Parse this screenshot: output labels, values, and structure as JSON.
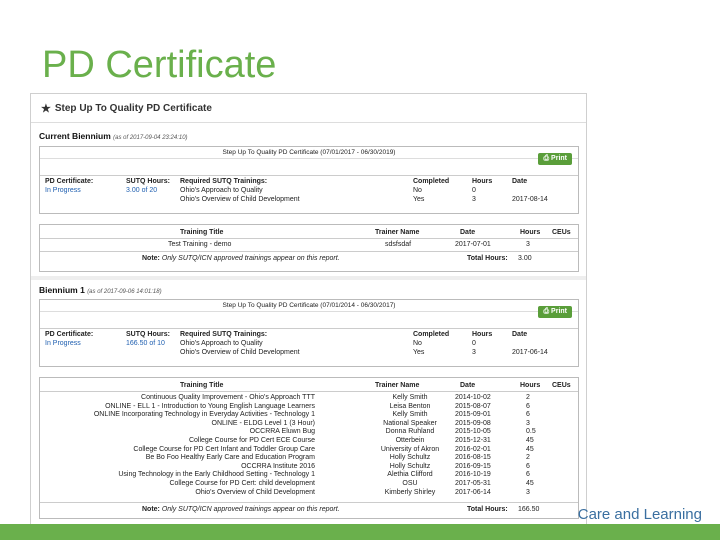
{
  "slide": {
    "title": "PD Certificate",
    "footer_text": "Care and Learning"
  },
  "app": {
    "header": "Step Up To Quality PD Certificate",
    "print_label": "Print"
  },
  "current": {
    "title": "Current Biennium",
    "timestamp": "(as of 2017-09-04 23:24:10)",
    "cert_header": "Step Up To Quality PD Certificate (07/01/2017 - 06/30/2019)",
    "cols": [
      "PD Certificate:",
      "SUTQ Hours:",
      "Required SUTQ Trainings:",
      "Completed",
      "Hours",
      "Date"
    ],
    "cert_status": "In Progress",
    "sutq_hours": "3.00 of 20",
    "required": [
      {
        "name": "Ohio's Approach to Quality",
        "completed": "No",
        "hours": "0",
        "date": ""
      },
      {
        "name": "Ohio's Overview of Child Development",
        "completed": "Yes",
        "hours": "3",
        "date": "2017-08-14"
      }
    ],
    "train_cols": [
      "Training Title",
      "Trainer Name",
      "Date",
      "Hours",
      "CEUs"
    ],
    "trainings": [
      {
        "title": "Test Training - demo",
        "trainer": "sdsfsdaf",
        "date": "2017-07-01",
        "hours": "3",
        "ceus": ""
      }
    ],
    "note_label": "Note:",
    "note_text": "Only SUTQ/ICN approved trainings appear on this report.",
    "total_label": "Total Hours:",
    "total_value": "3.00"
  },
  "biennium1": {
    "title": "Biennium 1",
    "timestamp": "(as of 2017-09-06 14:01:18)",
    "cert_header": "Step Up To Quality PD Certificate (07/01/2014 - 06/30/2017)",
    "cols": [
      "PD Certificate:",
      "SUTQ Hours:",
      "Required SUTQ Trainings:",
      "Completed",
      "Hours",
      "Date"
    ],
    "cert_status": "In Progress",
    "sutq_hours": "166.50 of 10",
    "required": [
      {
        "name": "Ohio's Approach to Quality",
        "completed": "No",
        "hours": "0",
        "date": ""
      },
      {
        "name": "Ohio's Overview of Child Development",
        "completed": "Yes",
        "hours": "3",
        "date": "2017-06-14"
      }
    ],
    "train_cols": [
      "Training Title",
      "Trainer Name",
      "Date",
      "Hours",
      "CEUs"
    ],
    "trainings": [
      {
        "title": "Continuous Quality Improvement - Ohio's Approach TTT",
        "trainer": "Kelly Smith",
        "date": "2014-10-02",
        "hours": "2",
        "ceus": ""
      },
      {
        "title": "ONLINE - ELL 1 - Introduction to Young English Language Learners",
        "trainer": "Leisa Benton",
        "date": "2015-08-07",
        "hours": "6",
        "ceus": ""
      },
      {
        "title": "ONLINE Incorporating Technology in Everyday Activities - Technology 1",
        "trainer": "Kelly Smith",
        "date": "2015-09-01",
        "hours": "6",
        "ceus": ""
      },
      {
        "title": "ONLINE - ELDG Level 1 (3 Hour)",
        "trainer": "National Speaker",
        "date": "2015-09-08",
        "hours": "3",
        "ceus": ""
      },
      {
        "title": "OCCRRA Eluwn Bug",
        "trainer": "Donna Ruhland",
        "date": "2015-10-05",
        "hours": "0.5",
        "ceus": ""
      },
      {
        "title": "College Course for PD Cert ECE Course",
        "trainer": "Otterbein",
        "date": "2015-12-31",
        "hours": "45",
        "ceus": ""
      },
      {
        "title": "College Course for PD Cert Infant and Toddler Group Care",
        "trainer": "University of Akron",
        "date": "2016-02-01",
        "hours": "45",
        "ceus": ""
      },
      {
        "title": "Be Bo Foo Healthy Early Care and Education Program",
        "trainer": "Holly Schultz",
        "date": "2016-08-15",
        "hours": "2",
        "ceus": ""
      },
      {
        "title": "OCCRRA Institute 2016",
        "trainer": "Holly Schultz",
        "date": "2016-09-15",
        "hours": "6",
        "ceus": ""
      },
      {
        "title": "Using Technology in the Early Childhood Setting - Technology 1",
        "trainer": "Alethia Clifford",
        "date": "2016-10-19",
        "hours": "6",
        "ceus": ""
      },
      {
        "title": "College Course for PD Cert: child development",
        "trainer": "OSU",
        "date": "2017-05-31",
        "hours": "45",
        "ceus": ""
      },
      {
        "title": "Ohio's Overview of Child Development",
        "trainer": "Kimberly Shirley",
        "date": "2017-06-14",
        "hours": "3",
        "ceus": ""
      }
    ],
    "note_label": "Note:",
    "note_text": "Only SUTQ/ICN approved trainings appear on this report.",
    "total_label": "Total Hours:",
    "total_value": "166.50"
  }
}
